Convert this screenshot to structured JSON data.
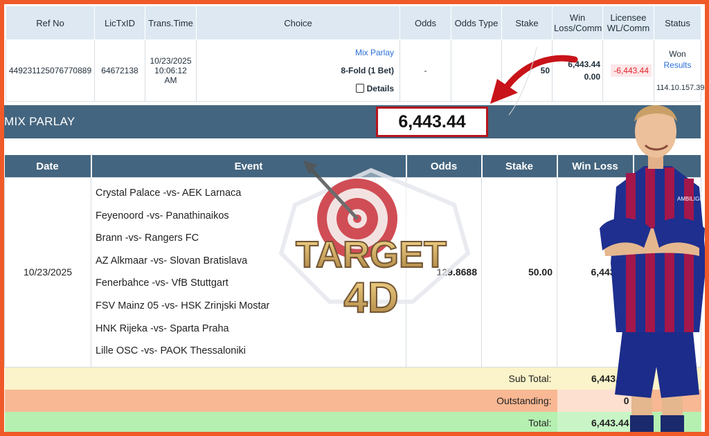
{
  "colors": {
    "frame": "#f05a28",
    "header_bg": "#44657f",
    "link": "#2a6fd8",
    "loss_red": "#e0242a",
    "amount_border": "#b6141c",
    "subtotal_bg": "#fbf3c9",
    "outstanding_bg": "#f8b894",
    "total_bg": "#b5f0b1"
  },
  "top_table": {
    "headers": {
      "ref_no": "Ref No",
      "lictxid": "LicTxID",
      "trans_time": "Trans.Time",
      "choice": "Choice",
      "odds": "Odds",
      "odds_type": "Odds Type",
      "stake": "Stake",
      "win_loss_line1": "Win",
      "win_loss_line2": "Loss/Comm",
      "licensee_line1": "Licensee",
      "licensee_line2": "WL/Comm",
      "status": "Status"
    },
    "row": {
      "ref_no": "449231125076770889",
      "lictxid": "64672138",
      "trans_date": "10/23/2025",
      "trans_time": "10:06:12 AM",
      "choice_type": "Mix Parlay",
      "choice_fold": "8-Fold (1 Bet)",
      "details_label": "Details",
      "details_icon": "copy-icon",
      "odds": "-",
      "odds_type": "",
      "stake": "50",
      "win_loss": "6,443.44",
      "comm": "0.00",
      "licensee_wl": "-6,443.44",
      "status": "Won",
      "results_link": "Results",
      "ip": "114.10.157.39"
    }
  },
  "parlay_bar": {
    "title": "MIX PARLAY",
    "amount": "6,443.44"
  },
  "detail_table": {
    "headers": {
      "date": "Date",
      "event": "Event",
      "odds": "Odds",
      "stake": "Stake",
      "win_loss": "Win Loss"
    },
    "date": "10/23/2025",
    "events": [
      "Crystal Palace -vs- AEK Larnaca",
      "Feyenoord -vs- Panathinaikos",
      "Brann -vs- Rangers FC",
      "AZ Alkmaar -vs- Slovan Bratislava",
      "Fenerbahce -vs- VfB Stuttgart",
      "FSV Mainz 05 -vs- HSK Zrinjski Mostar",
      "HNK Rijeka -vs- Sparta Praha",
      "Lille OSC -vs- PAOK Thessaloniki"
    ],
    "odds": "129.8688",
    "stake": "50.00",
    "win_loss": "6,443.44"
  },
  "summary": {
    "subtotal_label": "Sub Total:",
    "subtotal_value": "6,443.44",
    "outstanding_label": "Outstanding:",
    "outstanding_value": "0",
    "total_label": "Total:",
    "total_value": "6,443.44"
  },
  "watermark": {
    "line1": "TARGET",
    "line2": "4D",
    "icon": "dart-target-icon"
  },
  "player_jersey_text": "AMBILIGHT TV"
}
